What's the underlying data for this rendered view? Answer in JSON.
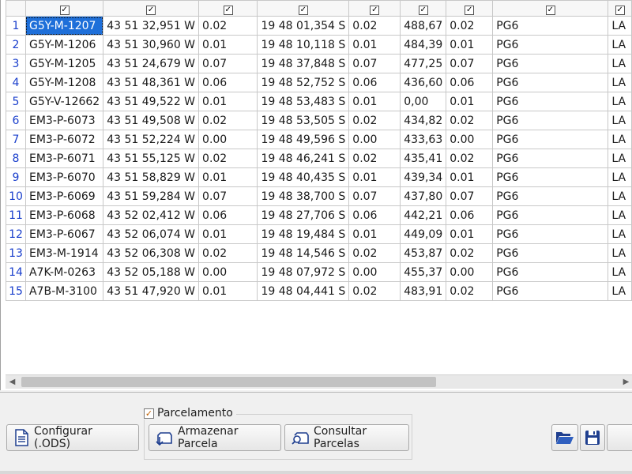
{
  "grid": {
    "header_check": "✓",
    "rows": [
      {
        "num": "1",
        "id": "G5Y-M-1207",
        "lon": "43 51 32,951 W",
        "lon_err": "0.02",
        "lat": "19 48 01,354 S",
        "lat_err": "0.02",
        "alt": "488,67",
        "alt_err": "0.02",
        "code": "PG6",
        "extra": "LA"
      },
      {
        "num": "2",
        "id": "G5Y-M-1206",
        "lon": "43 51 30,960 W",
        "lon_err": "0.01",
        "lat": "19 48 10,118 S",
        "lat_err": "0.01",
        "alt": "484,39",
        "alt_err": "0.01",
        "code": "PG6",
        "extra": "LA"
      },
      {
        "num": "3",
        "id": "G5Y-M-1205",
        "lon": "43 51 24,679 W",
        "lon_err": "0.07",
        "lat": "19 48 37,848 S",
        "lat_err": "0.07",
        "alt": "477,25",
        "alt_err": "0.07",
        "code": "PG6",
        "extra": "LA"
      },
      {
        "num": "4",
        "id": "G5Y-M-1208",
        "lon": "43 51 48,361 W",
        "lon_err": "0.06",
        "lat": "19 48 52,752 S",
        "lat_err": "0.06",
        "alt": "436,60",
        "alt_err": "0.06",
        "code": "PG6",
        "extra": "LA"
      },
      {
        "num": "5",
        "id": "G5Y-V-12662",
        "lon": "43 51 49,522 W",
        "lon_err": "0.01",
        "lat": "19 48 53,483 S",
        "lat_err": "0.01",
        "alt": "0,00",
        "alt_err": "0.01",
        "code": "PG6",
        "extra": "LA"
      },
      {
        "num": "6",
        "id": "EM3-P-6073",
        "lon": "43 51 49,508 W",
        "lon_err": "0.02",
        "lat": "19 48 53,505 S",
        "lat_err": "0.02",
        "alt": "434,82",
        "alt_err": "0.02",
        "code": "PG6",
        "extra": "LA"
      },
      {
        "num": "7",
        "id": "EM3-P-6072",
        "lon": "43 51 52,224 W",
        "lon_err": "0.00",
        "lat": "19 48 49,596 S",
        "lat_err": "0.00",
        "alt": "433,63",
        "alt_err": "0.00",
        "code": "PG6",
        "extra": "LA"
      },
      {
        "num": "8",
        "id": "EM3-P-6071",
        "lon": "43 51 55,125 W",
        "lon_err": "0.02",
        "lat": "19 48 46,241 S",
        "lat_err": "0.02",
        "alt": "435,41",
        "alt_err": "0.02",
        "code": "PG6",
        "extra": "LA"
      },
      {
        "num": "9",
        "id": "EM3-P-6070",
        "lon": "43 51 58,829 W",
        "lon_err": "0.01",
        "lat": "19 48 40,435 S",
        "lat_err": "0.01",
        "alt": "439,34",
        "alt_err": "0.01",
        "code": "PG6",
        "extra": "LA"
      },
      {
        "num": "10",
        "id": "EM3-P-6069",
        "lon": "43 51 59,284 W",
        "lon_err": "0.07",
        "lat": "19 48 38,700 S",
        "lat_err": "0.07",
        "alt": "437,80",
        "alt_err": "0.07",
        "code": "PG6",
        "extra": "LA"
      },
      {
        "num": "11",
        "id": "EM3-P-6068",
        "lon": "43 52 02,412 W",
        "lon_err": "0.06",
        "lat": "19 48 27,706 S",
        "lat_err": "0.06",
        "alt": "442,21",
        "alt_err": "0.06",
        "code": "PG6",
        "extra": "LA"
      },
      {
        "num": "12",
        "id": "EM3-P-6067",
        "lon": "43 52 06,074 W",
        "lon_err": "0.01",
        "lat": "19 48 19,484 S",
        "lat_err": "0.01",
        "alt": "449,09",
        "alt_err": "0.01",
        "code": "PG6",
        "extra": "LA"
      },
      {
        "num": "13",
        "id": "EM3-M-1914",
        "lon": "43 52 06,308 W",
        "lon_err": "0.02",
        "lat": "19 48 14,546 S",
        "lat_err": "0.02",
        "alt": "453,87",
        "alt_err": "0.02",
        "code": "PG6",
        "extra": "LA"
      },
      {
        "num": "14",
        "id": "A7K-M-0263",
        "lon": "43 52 05,188 W",
        "lon_err": "0.00",
        "lat": "19 48 07,972 S",
        "lat_err": "0.00",
        "alt": "455,37",
        "alt_err": "0.00",
        "code": "PG6",
        "extra": "LA"
      },
      {
        "num": "15",
        "id": "A7B-M-3100",
        "lon": "43 51 47,920 W",
        "lon_err": "0.01",
        "lat": "19 48 04,441 S",
        "lat_err": "0.02",
        "alt": "483,91",
        "alt_err": "0.02",
        "code": "PG6",
        "extra": "LA"
      }
    ]
  },
  "toolbar": {
    "configure_label": "Configurar (.ODS)",
    "group_label": "Parcelamento",
    "group_checked": "✓",
    "store_label": "Armazenar Parcela",
    "query_label": "Consultar Parcelas"
  },
  "icons": {
    "configure": "document-icon",
    "store": "store-parcel-icon",
    "query": "search-parcels-icon",
    "open": "folder-open-icon",
    "save": "save-disk-icon"
  },
  "colors": {
    "selection": "#1e6fd9",
    "row_number": "#1a3fcc",
    "icon_blue": "#1f3f8f"
  }
}
